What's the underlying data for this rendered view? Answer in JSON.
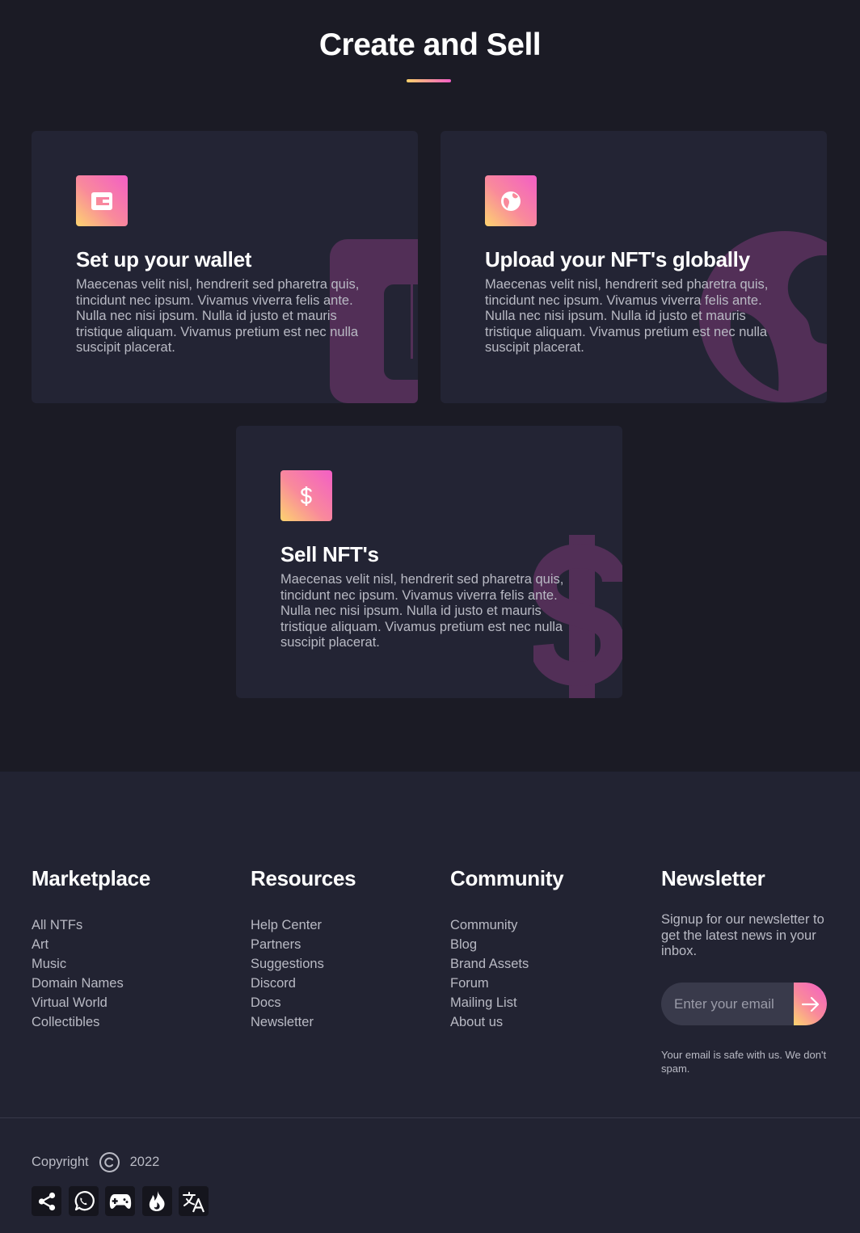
{
  "section": {
    "title": "Create and Sell"
  },
  "cards": [
    {
      "title": "Set up your wallet",
      "text": "Maecenas velit nisl, hendrerit sed pharetra quis, tincidunt nec ipsum. Vivamus viverra felis ante. Nulla nec nisi ipsum. Nulla id justo et mauris tristique aliquam. Vivamus pretium est nec nulla suscipit placerat.",
      "icon": "wallet-icon"
    },
    {
      "title": "Upload your NFT's globally",
      "text": "Maecenas velit nisl, hendrerit sed pharetra quis, tincidunt nec ipsum. Vivamus viverra felis ante. Nulla nec nisi ipsum. Nulla id justo et mauris tristique aliquam. Vivamus pretium est nec nulla suscipit placerat.",
      "icon": "globe-icon"
    },
    {
      "title": "Sell NFT's",
      "text": "Maecenas velit nisl, hendrerit sed pharetra quis, tincidunt nec ipsum. Vivamus viverra felis ante. Nulla nec nisi ipsum. Nulla id justo et mauris tristique aliquam. Vivamus pretium est nec nulla suscipit placerat.",
      "icon": "dollar-icon"
    }
  ],
  "footer": {
    "columns": [
      {
        "heading": "Marketplace",
        "links": [
          "All NTFs",
          "Art",
          "Music",
          "Domain Names",
          "Virtual World",
          "Collectibles"
        ]
      },
      {
        "heading": "Resources",
        "links": [
          "Help Center",
          "Partners",
          "Suggestions",
          "Discord",
          "Docs",
          "Newsletter"
        ]
      },
      {
        "heading": "Community",
        "links": [
          "Community",
          "Blog",
          "Brand Assets",
          "Forum",
          "Mailing List",
          "About us"
        ]
      }
    ],
    "newsletter": {
      "heading": "Newsletter",
      "description": "Signup for our newsletter to get the latest news in your inbox.",
      "placeholder": "Enter your email",
      "note": "Your email is safe with us. We don't spam."
    },
    "copyright": {
      "label": "Copyright",
      "year": "2022"
    },
    "social_icons": [
      "share-icon",
      "whatsapp-icon",
      "gamepad-icon",
      "fire-icon",
      "translate-icon"
    ]
  },
  "colors": {
    "page_bg": "#1b1b25",
    "card_bg": "#232434",
    "footer_bg": "#222332",
    "accent_pink": "#f35ec6",
    "accent_yellow": "#fdd46f",
    "watermark": "#522f57"
  }
}
